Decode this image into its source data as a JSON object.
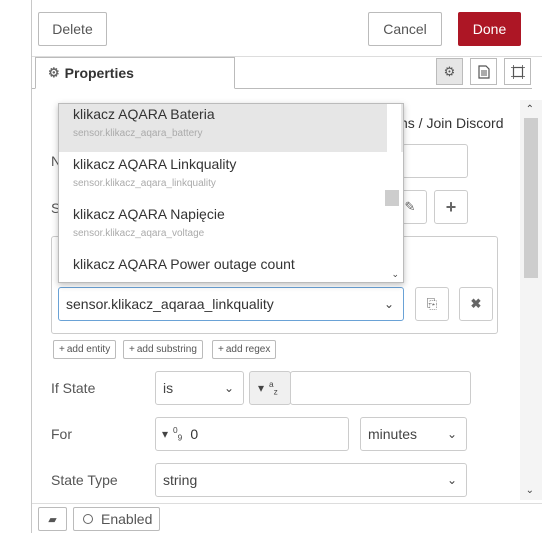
{
  "header": {
    "delete_label": "Delete",
    "cancel_label": "Cancel",
    "done_label": "Done"
  },
  "tabs": {
    "properties_label": "Properties",
    "icons": [
      "gear-icon",
      "document-icon",
      "frame-icon"
    ]
  },
  "form": {
    "partial_link": "ns / Join Discord",
    "name_label_partial": "N",
    "server_label_partial": "S",
    "entity_value": "sensor.klikacz_aqaraa_linkquality",
    "add_entity": "add entity",
    "add_substring": "add substring",
    "add_regex": "add regex",
    "if_state_label": "If State",
    "if_state_value": "is",
    "if_state_type": "a z",
    "for_label": "For",
    "for_type": "0 9",
    "for_value": "0",
    "for_unit": "minutes",
    "state_type_label": "State Type",
    "state_type_value": "string"
  },
  "dropdown": {
    "items": [
      {
        "name": "klikacz AQARA Bateria",
        "entity": "sensor.klikacz_aqara_battery"
      },
      {
        "name": "klikacz AQARA Linkquality",
        "entity": "sensor.klikacz_aqara_linkquality"
      },
      {
        "name": "klikacz AQARA Napięcie",
        "entity": "sensor.klikacz_aqara_voltage"
      },
      {
        "name": "klikacz AQARA Power outage count",
        "entity": ""
      }
    ]
  },
  "footer": {
    "enabled_label": "Enabled"
  },
  "colors": {
    "primary": "#ad1625",
    "focus_border": "#6aa2d6"
  }
}
